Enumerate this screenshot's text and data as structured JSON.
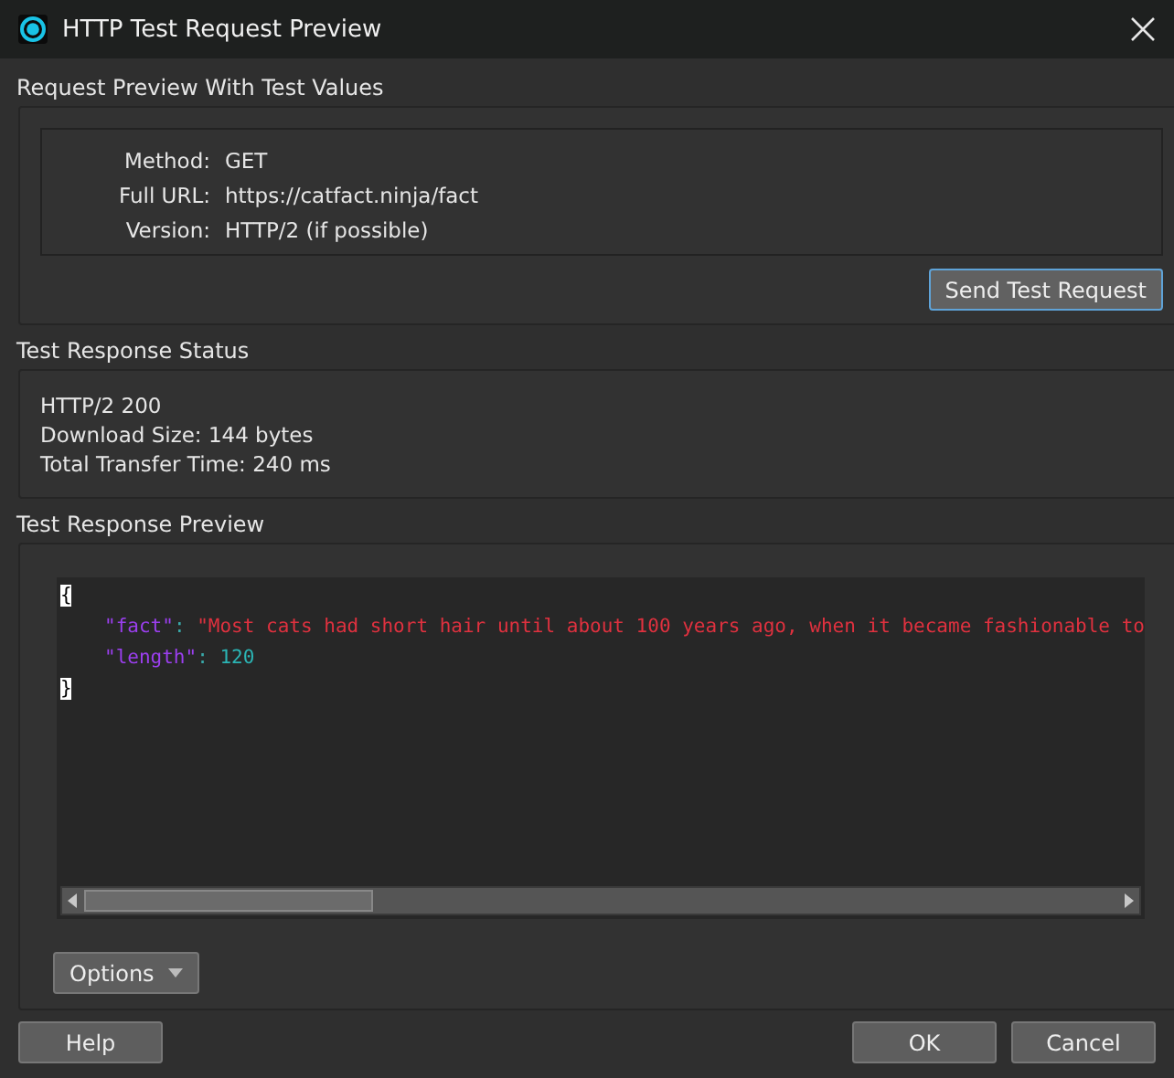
{
  "window": {
    "title": "HTTP Test Request Preview"
  },
  "request_preview": {
    "title": "Request Preview With Test Values",
    "fields": [
      {
        "label": "Method:",
        "value": "GET"
      },
      {
        "label": "Full URL:",
        "value": "https://catfact.ninja/fact"
      },
      {
        "label": "Version:",
        "value": "HTTP/2 (if possible)"
      }
    ],
    "button": "Send Test Request"
  },
  "response_status": {
    "title": "Test Response Status",
    "lines": [
      "HTTP/2 200",
      "Download Size: 144 bytes",
      "Total Transfer Time: 240 ms"
    ]
  },
  "response_preview": {
    "title": "Test Response Preview",
    "code_lines": [
      [
        {
          "kind": "brace",
          "text": "{"
        }
      ],
      [
        {
          "kind": "key",
          "text": "\"fact\""
        },
        {
          "kind": "punct",
          "text": ": "
        },
        {
          "kind": "string",
          "text": "\"Most cats had short hair until about 100 years ago, when it became fashionable to"
        }
      ],
      [
        {
          "kind": "key",
          "text": "\"length\""
        },
        {
          "kind": "punct",
          "text": ": "
        },
        {
          "kind": "number",
          "text": "120"
        }
      ],
      [
        {
          "kind": "brace",
          "text": "}"
        }
      ]
    ],
    "options_button": "Options"
  },
  "buttons": [
    {
      "label": "Help",
      "kind": "left"
    },
    {
      "label": "OK",
      "kind": "right"
    },
    {
      "label": "Cancel",
      "kind": "right"
    }
  ]
}
